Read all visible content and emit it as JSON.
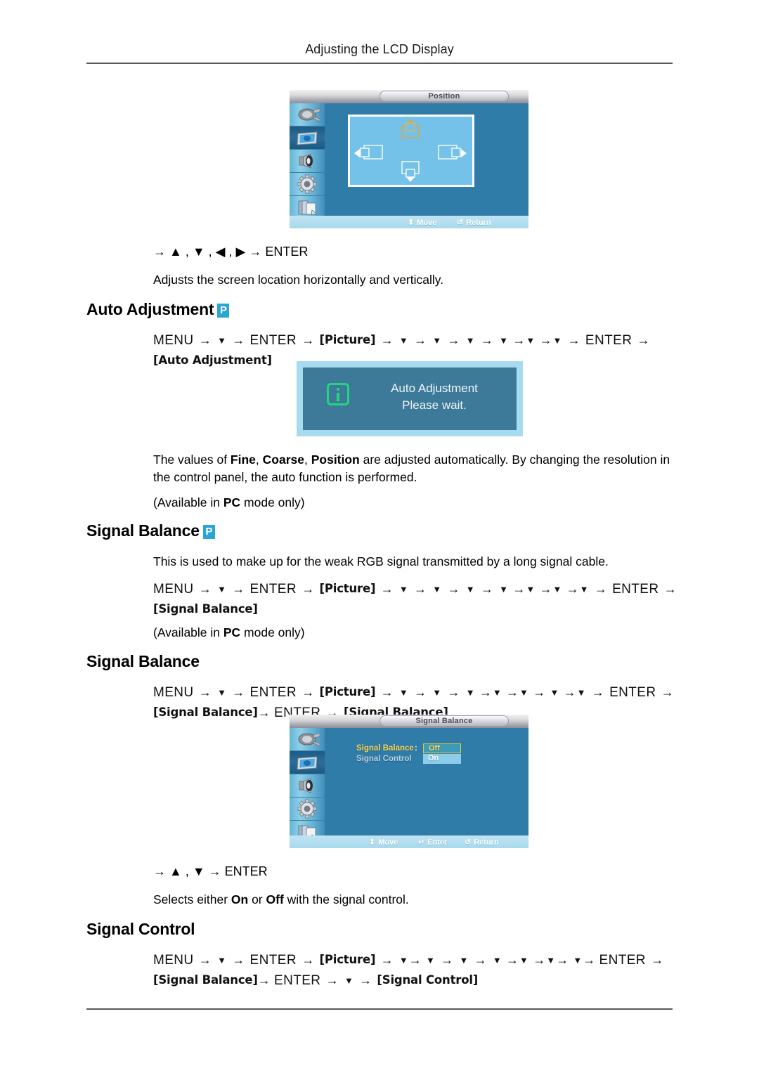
{
  "header": {
    "title": "Adjusting the LCD Display"
  },
  "position_osd": {
    "title": "Position",
    "sidebar_icons": [
      "input-plug-icon",
      "picture-icon",
      "sound-speaker-icon",
      "setup-gear-icon",
      "multi-control-icon"
    ],
    "selected_icon_index": 1,
    "panel_icons": [
      "position-up-icon",
      "position-left-icon",
      "position-right-icon",
      "position-down-icon"
    ],
    "footer_hints": [
      {
        "glyph": "⬍",
        "label": "Move"
      },
      {
        "glyph": "↺",
        "label": "Return"
      }
    ]
  },
  "position_keys": {
    "line": "→ ▲ , ▼ , ◀ , ▶ → ENTER",
    "description": "Adjusts the screen location horizontally and vertically."
  },
  "auto_adjustment": {
    "heading": "Auto Adjustment",
    "badge": "P",
    "path": {
      "menu": "MENU",
      "enter": "ENTER",
      "picture": "[Picture]",
      "target": "[Auto Adjustment]"
    },
    "dialog": {
      "title": "Auto Adjustment",
      "subtitle": "Please wait.",
      "icon": "info-icon"
    },
    "description_1": "The values of ",
    "description_fine": "Fine",
    "description_2": ", ",
    "description_coarse": "Coarse",
    "description_3": ", ",
    "description_position": "Position",
    "description_4": " are adjusted automatically. By changing the resolution in the control panel, the auto function is performed.",
    "availability_pre": "(Available in ",
    "availability_mode": "PC",
    "availability_post": " mode only)"
  },
  "signal_balance_1": {
    "heading": "Signal Balance",
    "badge": "P",
    "description": "This is used to make up for the weak RGB signal transmitted by a long signal cable.",
    "path": {
      "menu": "MENU",
      "enter": "ENTER",
      "picture": "[Picture]",
      "target": "[Signal Balance]"
    },
    "availability_pre": "(Available in ",
    "availability_mode": "PC",
    "availability_post": " mode only)"
  },
  "signal_balance_2": {
    "heading": "Signal Balance",
    "path": {
      "menu": "MENU",
      "enter": "ENTER",
      "picture": "[Picture]",
      "target_1": "[Signal Balance]",
      "enter_2": "ENTER",
      "target_2": "[Signal Balance]"
    },
    "osd": {
      "title": "Signal Balance",
      "rows": [
        {
          "label": "Signal Balance",
          "state": "active"
        },
        {
          "label": "Signal Control",
          "state": "dim"
        }
      ],
      "colon": ":",
      "options": [
        {
          "label": "Off",
          "selected": true
        },
        {
          "label": "On",
          "selected": false
        }
      ],
      "footer_hints": [
        {
          "glyph": "⬍",
          "label": "Move"
        },
        {
          "glyph": "↵",
          "label": "Enter"
        },
        {
          "glyph": "↺",
          "label": "Return"
        }
      ]
    },
    "keys_line": "→ ▲ , ▼ → ENTER",
    "description_pre": "Selects either ",
    "description_on": "On",
    "description_mid": " or ",
    "description_off": "Off",
    "description_post": " with the signal control."
  },
  "signal_control": {
    "heading": "Signal Control",
    "path": {
      "menu": "MENU",
      "enter": "ENTER",
      "picture": "[Picture]",
      "target_1": "[Signal Balance]",
      "enter_2": "ENTER",
      "target_2": "[Signal Control]"
    }
  },
  "glyphs": {
    "arrow_right": "→",
    "down_tri": "▼",
    "up_tri": "▲",
    "left_tri": "◀",
    "right_tri": "▶"
  }
}
